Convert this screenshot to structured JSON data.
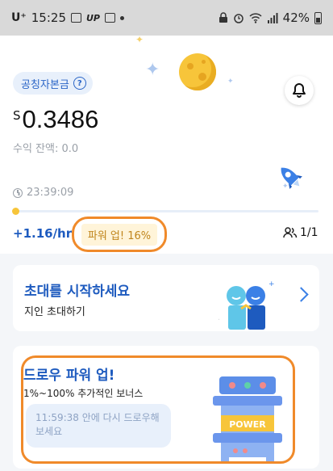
{
  "status_bar": {
    "carrier": "U⁺",
    "time": "15:25",
    "up_label": "UP",
    "battery": "42%"
  },
  "header": {
    "verified_pill": "공칭자본금",
    "help_icon": "?"
  },
  "balance": {
    "currency": "S",
    "amount": "0.3486",
    "sub_label": "수익 잔액: 0.0"
  },
  "mining": {
    "timer": "23:39:09",
    "progress": 0.01,
    "rate": "+1.16/hr",
    "power_badge": "파워 업! 16%",
    "team_count": "1/1"
  },
  "invite_card": {
    "title": "초대를 시작하세요",
    "subtitle": "지인 초대하기"
  },
  "draw_card": {
    "title": "드로우 파워 업!",
    "subtitle": "1%~100% 추가적인 보너스",
    "cooldown": "11:59:38 안에 다시 드로우해 보세요",
    "machine_label": "POWER"
  },
  "colors": {
    "accent_blue": "#1e5bbf",
    "highlight_orange": "#f08a2a",
    "moon_yellow": "#f7c53a"
  }
}
